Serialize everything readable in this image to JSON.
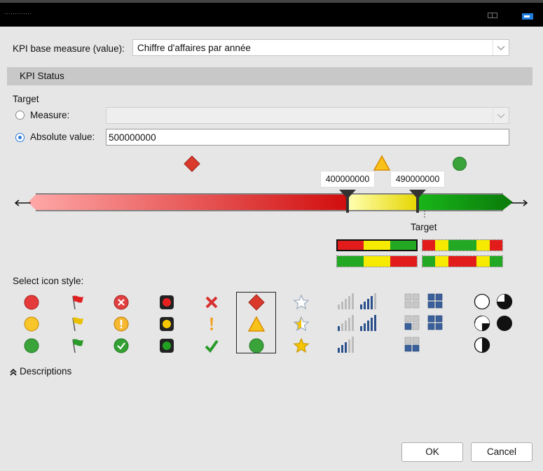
{
  "window": {
    "title": "·············"
  },
  "base_measure": {
    "label": "KPI base measure (value):",
    "value": "Chiffre d'affaires par année"
  },
  "status_section": {
    "title": "KPI Status"
  },
  "target": {
    "heading": "Target",
    "measure_label": "Measure:",
    "measure_value": "",
    "absolute_label": "Absolute value:",
    "absolute_value": "500000000",
    "selected": "absolute"
  },
  "thresholds": {
    "low": "400000000",
    "high": "490000000",
    "target_label": "Target"
  },
  "status_icons": [
    "red-diamond-icon",
    "yellow-triangle-icon",
    "green-circle-icon"
  ],
  "icon_style": {
    "label": "Select icon style:",
    "selected_index": 4
  },
  "descriptions": {
    "label": "Descriptions"
  },
  "buttons": {
    "ok": "OK",
    "cancel": "Cancel"
  },
  "colors": {
    "red": "#d81e1e",
    "yellow": "#f5ea00",
    "green": "#22a822",
    "selected_radio": "#2a7ad8"
  }
}
